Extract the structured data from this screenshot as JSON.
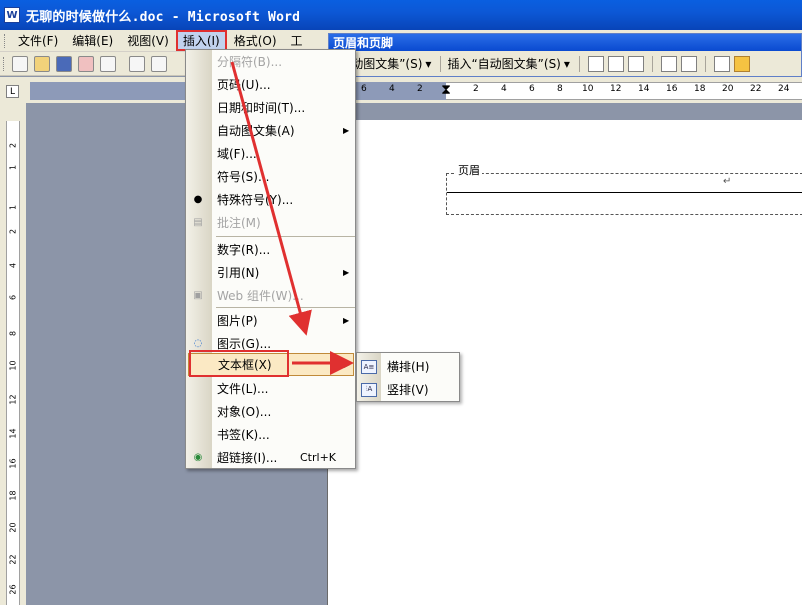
{
  "window": {
    "app_icon": "W",
    "title": "无聊的时候做什么.doc - Microsoft Word"
  },
  "menubar": [
    {
      "label": "文件(F)"
    },
    {
      "label": "编辑(E)"
    },
    {
      "label": "视图(V)"
    },
    {
      "label": "插入(I)"
    },
    {
      "label": "格式(O)"
    },
    {
      "label": "工"
    }
  ],
  "hf_toolbar": {
    "title": "页眉和页脚",
    "insert_autotext_1": "“自动图文集”(S)",
    "insert_autotext_2": "插入“自动图文集”(S)"
  },
  "ruler": {
    "corner": "L",
    "numbers": [
      "6",
      "4",
      "2",
      "2",
      "4",
      "6",
      "8",
      "10",
      "12",
      "14",
      "16",
      "18",
      "20",
      "22",
      "24"
    ],
    "vnumbers": [
      "2",
      "1",
      "",
      "1",
      "2",
      "4",
      "6",
      "8",
      "10",
      "12",
      "14",
      "16",
      "18",
      "20",
      "22",
      "24",
      "26"
    ]
  },
  "document": {
    "header_label": "页眉",
    "para_mark": "↵"
  },
  "insert_menu": {
    "items": [
      {
        "label": "分隔符(B)...",
        "disabled": true,
        "icon": ""
      },
      {
        "label": "页码(U)...",
        "disabled": false,
        "icon": ""
      },
      {
        "label": "日期和时间(T)...",
        "disabled": false,
        "icon": ""
      },
      {
        "label": "自动图文集(A)",
        "disabled": false,
        "icon": "",
        "submenu": true
      },
      {
        "label": "域(F)...",
        "disabled": false,
        "icon": ""
      },
      {
        "label": "符号(S)...",
        "disabled": false,
        "icon": ""
      },
      {
        "label": "特殊符号(Y)...",
        "disabled": false,
        "icon": "bullet-icon"
      },
      {
        "label": "批注(M)",
        "disabled": true,
        "icon": "comment-icon"
      },
      {
        "label": "数字(R)...",
        "disabled": false,
        "icon": ""
      },
      {
        "label": "引用(N)",
        "disabled": false,
        "icon": "",
        "submenu": true
      },
      {
        "label": "Web 组件(W)...",
        "disabled": true,
        "icon": "web-component-icon"
      },
      {
        "label": "图片(P)",
        "disabled": false,
        "icon": "",
        "submenu": true
      },
      {
        "label": "图示(G)...",
        "disabled": false,
        "icon": "diagram-icon"
      },
      {
        "label": "文本框(X)",
        "disabled": false,
        "icon": "",
        "submenu": true,
        "highlighted": true
      },
      {
        "label": "文件(L)...",
        "disabled": false,
        "icon": ""
      },
      {
        "label": "对象(O)...",
        "disabled": false,
        "icon": ""
      },
      {
        "label": "书签(K)...",
        "disabled": false,
        "icon": ""
      },
      {
        "label": "超链接(I)...",
        "disabled": false,
        "icon": "hyperlink-icon",
        "shortcut": "Ctrl+K"
      }
    ]
  },
  "textbox_submenu": {
    "items": [
      {
        "label": "横排(H)",
        "icon": "horizontal-textbox-icon"
      },
      {
        "label": "竖排(V)",
        "icon": "vertical-textbox-icon"
      }
    ]
  },
  "colors": {
    "annotation_red": "#e03030",
    "titlebar_blue": "#0a58d6",
    "menu_highlight": "#fbe9c4"
  }
}
